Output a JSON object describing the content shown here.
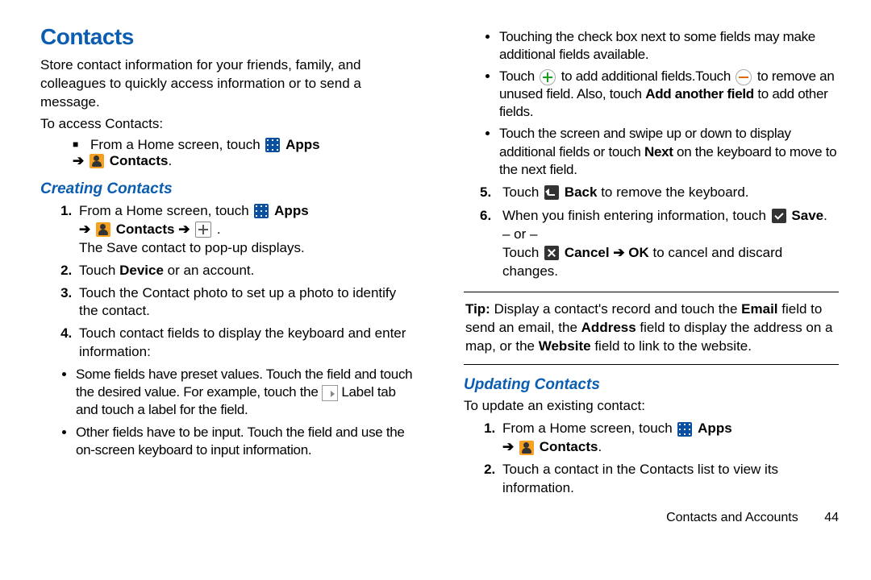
{
  "title": "Contacts",
  "intro": "Store contact information for your friends, family, and colleagues to quickly access information or to send a message.",
  "access_label": "To access Contacts:",
  "access_step_prefix": "From a Home screen, touch ",
  "apps_label": "Apps",
  "contacts_label": "Contacts",
  "h_creating": "Creating Contacts",
  "creating": {
    "s1_prefix": "From a Home screen, touch ",
    "s1_after": "The Save contact to pop-up displays.",
    "s2_a": "Touch ",
    "s2_b": "Device",
    "s2_c": " or an account.",
    "s3": "Touch the Contact photo to set up a photo to identify the contact.",
    "s4": "Touch contact fields to display the keyboard and enter information:",
    "b1_a": "Some fields have preset values. Touch the field and touch the desired value. For example, touch the ",
    "b1_b": " Label tab and touch a label for the field.",
    "b2": "Other fields have to be input. Touch the field and use the on-screen keyboard to input information."
  },
  "col2": {
    "b3": "Touching the check box next to some fields may make additional fields available.",
    "b4_a": "Touch ",
    "b4_b": " to add additional fields.Touch ",
    "b4_c": " to remove an unused field. Also, touch ",
    "b4_bold": "Add another field",
    "b4_d": " to add other fields.",
    "b5_a": "Touch the screen and swipe up or down to display additional fields or touch ",
    "b5_bold": "Next",
    "b5_b": " on the keyboard to move to the next field.",
    "s5_a": "Touch ",
    "s5_bold": "Back",
    "s5_b": " to remove the keyboard.",
    "s6_a": "When you finish entering information, touch ",
    "s6_bold": "Save",
    "or": "– or –",
    "s6_b": "Touch ",
    "cancel": "Cancel",
    "arrow": "➔",
    "ok": "OK",
    "s6_c": " to cancel and discard changes."
  },
  "tip_label": "Tip:",
  "tip_a": " Display a contact's record and touch the ",
  "tip_email": "Email",
  "tip_b": " field to send an email, the ",
  "tip_address": "Address",
  "tip_c": " field to display the address on a map, or the ",
  "tip_website": "Website",
  "tip_d": " field to link to the website.",
  "h_updating": "Updating Contacts",
  "updating_intro": "To update an existing contact:",
  "u1_prefix": "From a Home screen, touch ",
  "u2": "Touch a contact in the Contacts list to view its information.",
  "footer_section": "Contacts and Accounts",
  "footer_page": "44"
}
